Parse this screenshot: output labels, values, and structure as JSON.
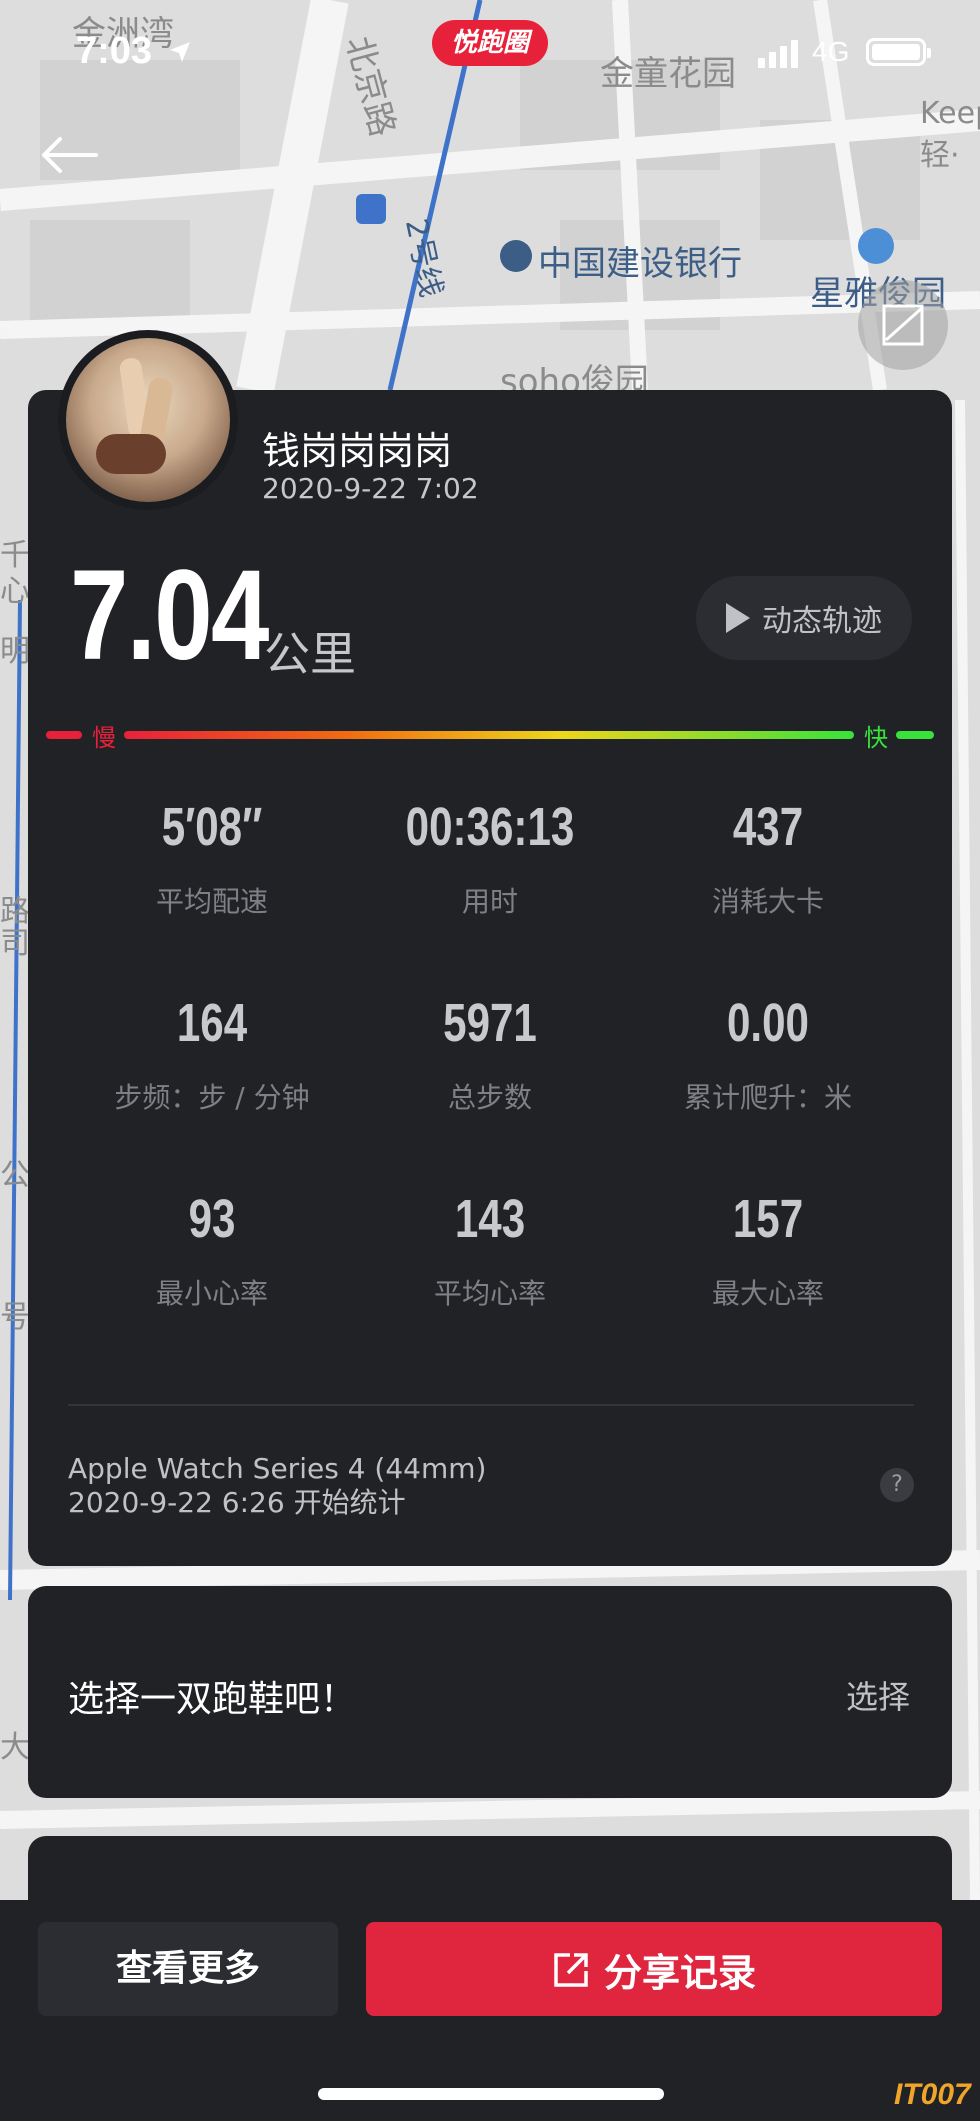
{
  "status_bar": {
    "time": "7:03",
    "network": "4G"
  },
  "app_badge": "悦跑圈",
  "map": {
    "labels": [
      "金洲湾",
      "北京路",
      "金童花园",
      "Keep",
      "轻·",
      "中国建设银行",
      "星雅俊园",
      "2号线",
      "soho俊园",
      "千",
      "心",
      "明",
      "路",
      "司",
      "公",
      "号",
      "大"
    ]
  },
  "user": {
    "name": "钱岗岗岗岗",
    "record_time": "2020-9-22 7:02"
  },
  "distance": {
    "value": "7.04",
    "unit": "公里"
  },
  "track_button": "动态轨迹",
  "speed_bar": {
    "slow": "慢",
    "fast": "快"
  },
  "stats": [
    {
      "value": "5′08″",
      "label": "平均配速"
    },
    {
      "value": "00:36:13",
      "label": "用时"
    },
    {
      "value": "437",
      "label": "消耗大卡"
    },
    {
      "value": "164",
      "label": "步频：步 / 分钟"
    },
    {
      "value": "5971",
      "label": "总步数"
    },
    {
      "value": "0.00",
      "label": "累计爬升：米"
    },
    {
      "value": "93",
      "label": "最小心率"
    },
    {
      "value": "143",
      "label": "平均心率"
    },
    {
      "value": "157",
      "label": "最大心率"
    }
  ],
  "device": {
    "name": "Apple Watch Series 4 (44mm)",
    "start": "2020-9-22 6:26 开始统计"
  },
  "help_label": "?",
  "shoe": {
    "prompt": "选择一双跑鞋吧！",
    "action": "选择"
  },
  "bottom": {
    "more": "查看更多",
    "share": "分享记录"
  },
  "watermark": "IT007",
  "colors": {
    "accent_red": "#e0253f",
    "card": "#202226",
    "fast_green": "#38e23b"
  }
}
